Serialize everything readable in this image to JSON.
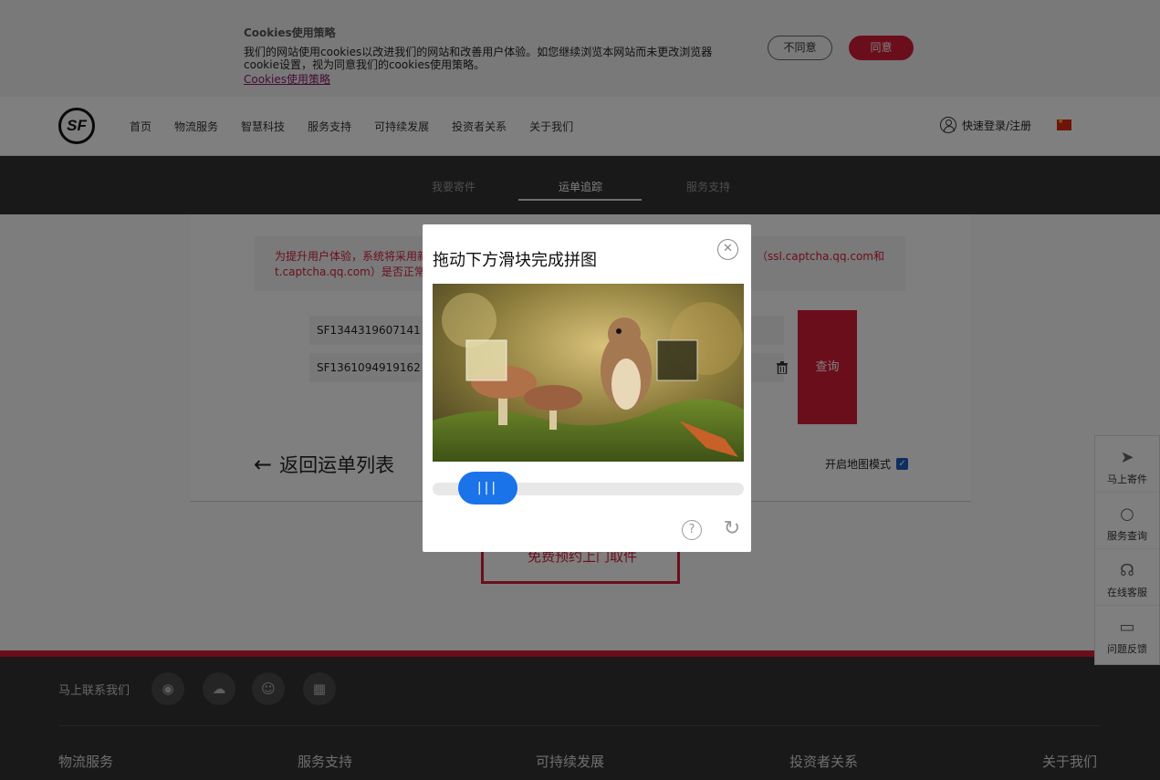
{
  "cookie": {
    "title": "Cookies使用策略",
    "text": "我们的网站使用cookies以改进我们的网站和改善用户体验。如您继续浏览本网站而未更改浏览器cookie设置，视为同意我们的cookies使用策略。",
    "link": "Cookies使用策略",
    "disagree": "不同意",
    "agree": "同意"
  },
  "header": {
    "logo": "SF",
    "nav": [
      "首页",
      "物流服务",
      "智慧科技",
      "服务支持",
      "可持续发展",
      "投资者关系",
      "关于我们"
    ],
    "login": "快速登录/注册"
  },
  "tabs": [
    "我要寄件",
    "运单追踪",
    "服务支持"
  ],
  "active_tab": "运单追踪",
  "notice": {
    "line1": "为提升用户体验，系统将采用新",
    "line2": "t.captcha.qq.com）是否正常。",
    "line1_right": "（ssl.captcha.qq.com和"
  },
  "waybills": [
    "SF1344319607141",
    "SF1361094919162"
  ],
  "query_button": "查询",
  "back_label": "返回运单列表",
  "map_mode_label": "开启地图模式",
  "map_mode_checked": true,
  "pickup_button": "免费预约上门取件",
  "captcha": {
    "title": "拖动下方滑块完成拼图",
    "slider_handle": "|||",
    "slider_progress": 0.09
  },
  "sidebar": [
    "马上寄件",
    "服务查询",
    "在线客服",
    "问题反馈"
  ],
  "footer": {
    "contact": "马上联系我们",
    "columns": [
      "物流服务",
      "服务支持",
      "可持续发展",
      "投资者关系",
      "关于我们"
    ]
  },
  "colors": {
    "brand_red": "#d71d38",
    "dark": "#333333",
    "slider_blue": "#1a73e8"
  }
}
